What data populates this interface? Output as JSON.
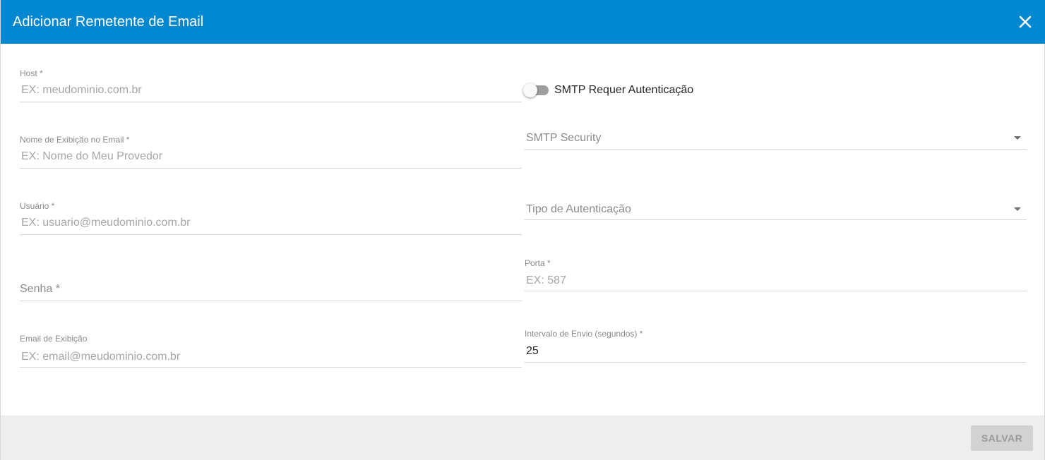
{
  "dialog": {
    "title": "Adicionar Remetente de Email",
    "close_icon": "close-icon",
    "accent_color": "#0288d1"
  },
  "form": {
    "host": {
      "label": "Host *",
      "placeholder": "EX: meudominio.com.br",
      "value": ""
    },
    "display_name": {
      "label": "Nome de Exibição no Email *",
      "placeholder": "EX: Nome do Meu Provedor",
      "value": ""
    },
    "user": {
      "label": "Usuário *",
      "placeholder": "EX: usuario@meudominio.com.br",
      "value": ""
    },
    "password": {
      "label": "Senha *",
      "value": ""
    },
    "display_email": {
      "label": "Email de Exibição",
      "placeholder": "EX: email@meudominio.com.br",
      "value": ""
    },
    "smtp_auth_toggle": {
      "label": "SMTP Requer Autenticação",
      "checked": false
    },
    "smtp_security": {
      "label": "SMTP Security",
      "selected": ""
    },
    "auth_type": {
      "label": "Tipo de Autenticação",
      "selected": ""
    },
    "port": {
      "label": "Porta *",
      "placeholder": "EX: 587",
      "value": ""
    },
    "send_interval": {
      "label": "Intervalo de Envio (segundos) *",
      "value": "25"
    }
  },
  "footer": {
    "save_label": "SALVAR"
  }
}
